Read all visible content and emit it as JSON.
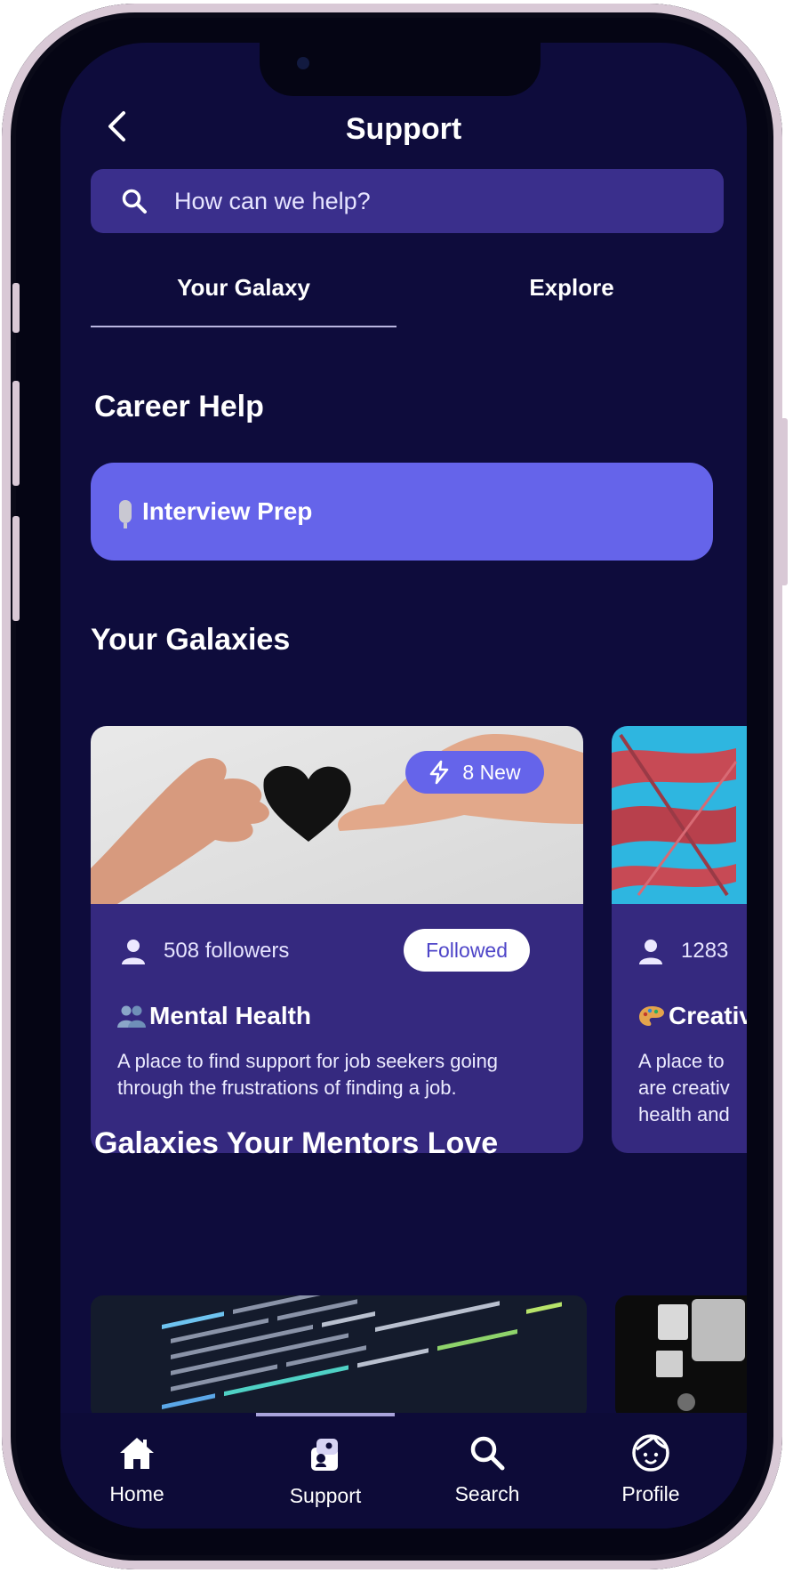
{
  "header": {
    "title": "Support",
    "back_icon": "chevron-left-icon"
  },
  "search": {
    "placeholder": "How can we help?"
  },
  "tabs": [
    {
      "label": "Your Galaxy",
      "active": true
    },
    {
      "label": "Explore",
      "active": false
    }
  ],
  "career_help": {
    "title": "Career Help",
    "interview_button": {
      "icon": "microphone-icon",
      "label": "Interview Prep"
    }
  },
  "your_galaxies": {
    "title": "Your Galaxies",
    "cards": [
      {
        "new_badge": "8 New",
        "followers": "508 followers",
        "follow_label": "Followed",
        "emoji_icon": "people-icon",
        "title": "Mental Health",
        "description": "A place to find support for job seekers going through the frustrations of finding a job."
      },
      {
        "followers": "1283",
        "emoji_icon": "palette-icon",
        "title": "Creativ",
        "description": "A place to\nare creativ\nhealth and"
      }
    ]
  },
  "mentors_love": {
    "title": "Galaxies Your Mentors Love"
  },
  "nav": [
    {
      "label": "Home",
      "icon": "home-icon"
    },
    {
      "label": "Support",
      "icon": "support-icon",
      "active": true
    },
    {
      "label": "Search",
      "icon": "search-icon"
    },
    {
      "label": "Profile",
      "icon": "profile-icon"
    }
  ],
  "colors": {
    "background": "#0e0c3c",
    "accent": "#6564ea",
    "card": "#35297f",
    "search_bg": "#3a2f8c"
  }
}
